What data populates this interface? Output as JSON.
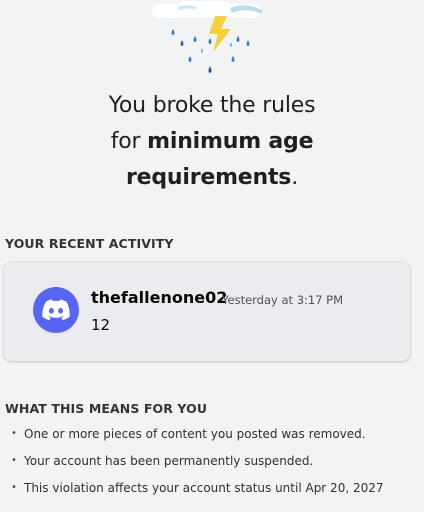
{
  "notice": {
    "line1": "You broke the rules",
    "line2_prefix": "for ",
    "line2_bold": "minimum age",
    "line3_bold": "requirements",
    "line3_suffix": "."
  },
  "activity": {
    "section_title": "YOUR RECENT ACTIVITY",
    "username": "thefallenone02",
    "timestamp": "Yesterday at 3:17 PM",
    "message": "12",
    "avatar_icon": "discord-logo-icon"
  },
  "meaning": {
    "section_title": "WHAT THIS MEANS FOR YOU",
    "items": [
      "One or more pieces of content you posted was removed.",
      "Your account has been permanently suspended.",
      "This violation affects your account status until Apr 20, 2027"
    ]
  },
  "colors": {
    "brand": "#5865f2",
    "background": "#f2f3f5"
  }
}
